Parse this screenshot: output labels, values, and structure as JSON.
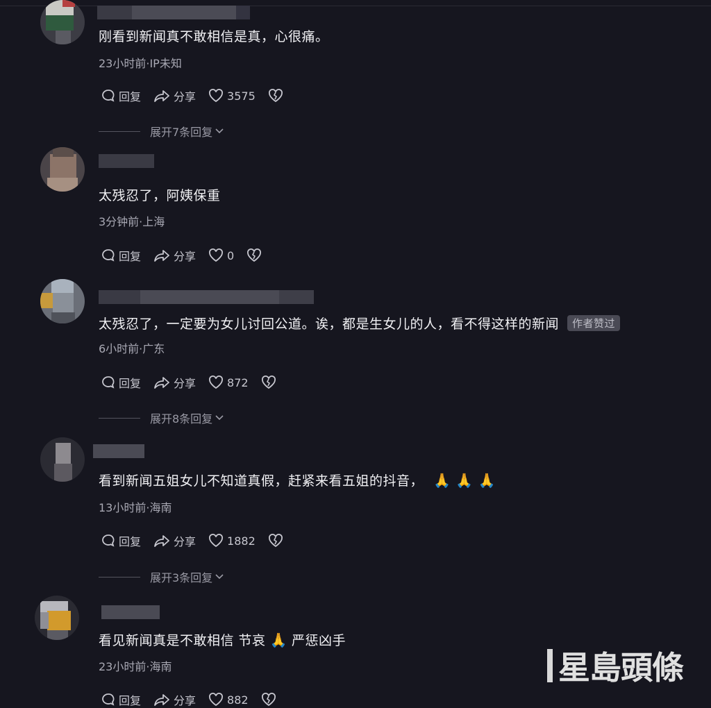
{
  "labels": {
    "reply": "回复",
    "share": "分享"
  },
  "comments": [
    {
      "text": "刚看到新闻真不敢相信是真，心很痛。",
      "meta": "23小时前·IP未知",
      "likes": "3575",
      "expand": "展开7条回复"
    },
    {
      "text": "太残忍了，阿姨保重",
      "meta": "3分钟前·上海",
      "likes": "0"
    },
    {
      "text": "太残忍了，一定要为女儿讨回公道。诶，都是生女儿的人，看不得这样的新闻",
      "badge": "作者赞过",
      "meta": "6小时前·广东",
      "likes": "872",
      "expand": "展开8条回复"
    },
    {
      "text": "看到新闻五姐女儿不知道真假，赶紧来看五姐的抖音，",
      "emojis": "🙏 🙏 🙏",
      "meta": "13小时前·海南",
      "likes": "1882",
      "expand": "展开3条回复"
    },
    {
      "text": "看见新闻真是不敢相信 节哀",
      "emoji_mid": "🙏",
      "text_after": "严惩凶手",
      "meta": "23小时前·海南",
      "likes": "882"
    }
  ],
  "watermark": "星島頭條",
  "colors": {
    "background": "#16161f",
    "text": "#f1f1f4",
    "meta": "#a9a9b4",
    "emoji": "#f3b33a"
  }
}
